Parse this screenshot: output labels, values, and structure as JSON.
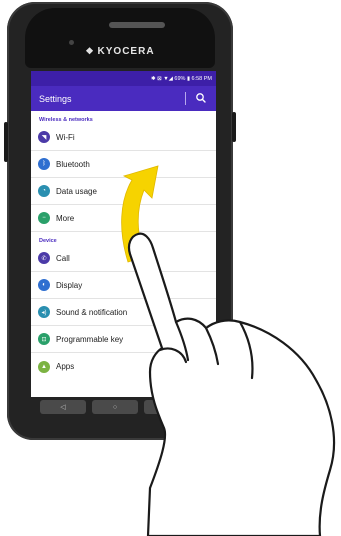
{
  "device": {
    "brand": "KYOCERA"
  },
  "status_bar": {
    "text": "✱ ⊠ ▼◢ 69% ▮ 6:58 PM"
  },
  "app_bar": {
    "title": "Settings"
  },
  "sections": [
    {
      "header": "Wireless & networks",
      "items": [
        {
          "label": "Wi-Fi",
          "icon": "wifi-icon",
          "color": "#4b3aa8"
        },
        {
          "label": "Bluetooth",
          "icon": "bluetooth-icon",
          "color": "#2f6fd0"
        },
        {
          "label": "Data usage",
          "icon": "data-usage-icon",
          "color": "#2a8fb0"
        },
        {
          "label": "More",
          "icon": "more-icon",
          "color": "#2aa06a"
        }
      ]
    },
    {
      "header": "Device",
      "items": [
        {
          "label": "Call",
          "icon": "phone-icon",
          "color": "#4b3aa8"
        },
        {
          "label": "Display",
          "icon": "display-icon",
          "color": "#2f6fd0"
        },
        {
          "label": "Sound & notification",
          "icon": "sound-icon",
          "color": "#2a8fb0"
        },
        {
          "label": "Programmable key",
          "icon": "programmable-key-icon",
          "color": "#2aa06a"
        },
        {
          "label": "Apps",
          "icon": "android-icon",
          "color": "#7cb342"
        }
      ]
    }
  ],
  "nav": {
    "back": "◁",
    "home": "○"
  },
  "colors": {
    "status_bar": "#3d1fa8",
    "app_bar": "#4a2bbf",
    "gesture_arrow": "#f6d300"
  }
}
